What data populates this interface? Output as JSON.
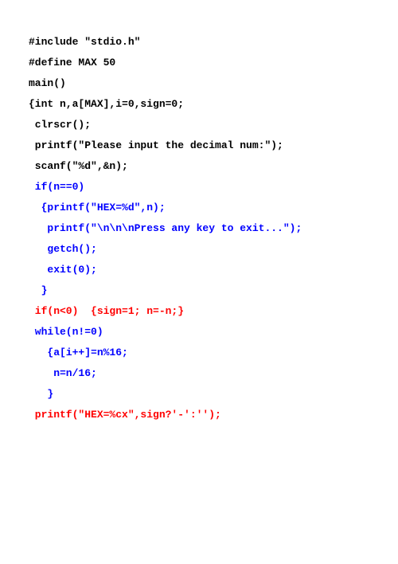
{
  "code": {
    "l01": "#include \"stdio.h\"",
    "l02": "#define MAX 50",
    "l03": "main()",
    "l04": "{int n,a[MAX],i=0,sign=0;",
    "l05": " clrscr();",
    "l06": " printf(\"Please input the decimal num:\");",
    "l07": " scanf(\"%d\",&n);",
    "l08a": " if(n==0)",
    "l09": "  {printf(\"HEX=%d\",n);",
    "l10": "   printf(\"\\n\\n\\nPress any key to exit...\");",
    "l11": "   getch();",
    "l12": "   exit(0);",
    "l13": "  }",
    "l14": " if(n<0)  {sign=1; n=-n;}",
    "l15": " while(n!=0)",
    "l16": "   {a[i++]=n%16;",
    "l17": "    n=n/16;",
    "l18": "   }",
    "l19": " printf(\"HEX=%cx\",sign?'-':'');"
  }
}
